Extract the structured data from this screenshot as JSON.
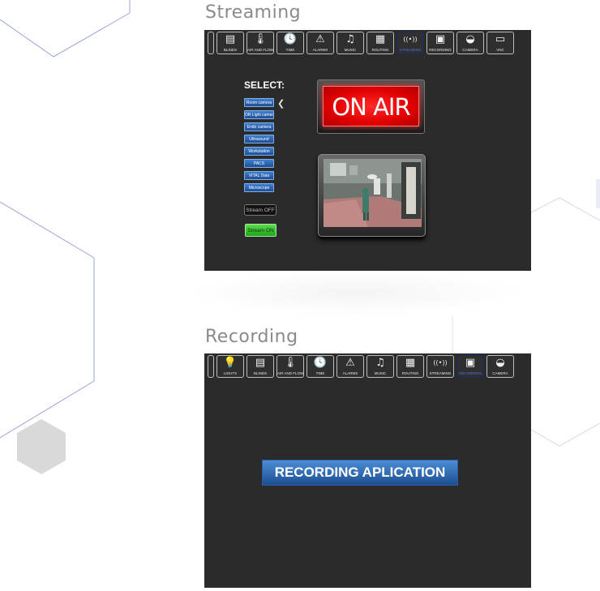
{
  "sections": {
    "streaming": {
      "title": "Streaming"
    },
    "recording": {
      "title": "Recording"
    }
  },
  "streaming_panel": {
    "toolbar": [
      {
        "label": "BLINDS",
        "icon": "blinds-icon",
        "glyph": "▤",
        "active": false
      },
      {
        "label": "AIR AND FLOW",
        "icon": "thermometer-icon",
        "glyph": "🌡",
        "active": false
      },
      {
        "label": "TIME",
        "icon": "clock-icon",
        "glyph": "🕓",
        "active": false
      },
      {
        "label": "ALARMS",
        "icon": "alarm-warning-icon",
        "glyph": "⚠",
        "active": false
      },
      {
        "label": "MUSIC",
        "icon": "music-note-icon",
        "glyph": "♫",
        "active": false
      },
      {
        "label": "ROUTING",
        "icon": "routing-icon",
        "glyph": "▦",
        "active": false
      },
      {
        "label": "STREAMING",
        "icon": "broadcast-icon",
        "glyph": "((•))",
        "active": true
      },
      {
        "label": "RECORDING",
        "icon": "recording-icon",
        "glyph": "▣",
        "active": false
      },
      {
        "label": "CAMERA",
        "icon": "dome-camera-icon",
        "glyph": "◒",
        "active": false
      },
      {
        "label": "VNC",
        "icon": "monitor-icon",
        "glyph": "▭",
        "active": false
      }
    ],
    "select_title": "SELECT:",
    "sources": [
      "Room camera",
      "OR Light camera",
      "Endo camera",
      "Ultrasound",
      "Workstation",
      "PACS",
      "VITAL Data",
      "Microscope"
    ],
    "arrow_glyph": "❮",
    "stream_off_label": "Stream OFF",
    "stream_on_label": "Stream ON",
    "on_air_label": "ON AIR"
  },
  "recording_panel": {
    "toolbar": [
      {
        "label": "LIGHTS",
        "icon": "lightbulb-icon",
        "glyph": "💡",
        "active": false
      },
      {
        "label": "BLINDS",
        "icon": "blinds-icon",
        "glyph": "▤",
        "active": false
      },
      {
        "label": "AIR AND FLOW",
        "icon": "thermometer-icon",
        "glyph": "🌡",
        "active": false
      },
      {
        "label": "TIME",
        "icon": "clock-icon",
        "glyph": "🕓",
        "active": false
      },
      {
        "label": "ALARMS",
        "icon": "alarm-warning-icon",
        "glyph": "⚠",
        "active": false
      },
      {
        "label": "MUSIC",
        "icon": "music-note-icon",
        "glyph": "♫",
        "active": false
      },
      {
        "label": "ROUTING",
        "icon": "routing-icon",
        "glyph": "▦",
        "active": false
      },
      {
        "label": "STREAMING",
        "icon": "broadcast-icon",
        "glyph": "((•))",
        "active": false
      },
      {
        "label": "RECORDING",
        "icon": "recording-icon",
        "glyph": "▣",
        "active": true
      },
      {
        "label": "CAMERA",
        "icon": "dome-camera-icon",
        "glyph": "◒",
        "active": false
      }
    ],
    "title": "RECORDING APLICATION"
  },
  "colors": {
    "panel_bg": "#2b2b2b",
    "on_air_red": "#e10000",
    "stream_on_green": "#3bc630",
    "select_blue": "#2e6bb8",
    "active_tab_text": "#5a6fd0",
    "title_gray": "#8a8a8a"
  }
}
